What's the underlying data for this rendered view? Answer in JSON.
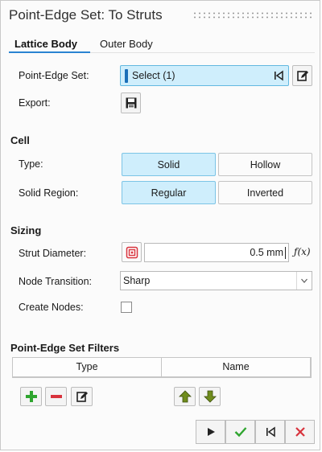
{
  "title": "Point-Edge Set: To Struts",
  "tabs": [
    {
      "label": "Lattice Body",
      "active": true
    },
    {
      "label": "Outer Body",
      "active": false
    }
  ],
  "point_edge_set": {
    "label": "Point-Edge Set:",
    "value": "Select (1)"
  },
  "export": {
    "label": "Export:"
  },
  "cell": {
    "heading": "Cell",
    "type": {
      "label": "Type:",
      "options": [
        "Solid",
        "Hollow"
      ],
      "selected": "Solid"
    },
    "solid_region": {
      "label": "Solid Region:",
      "options": [
        "Regular",
        "Inverted"
      ],
      "selected": "Regular"
    }
  },
  "sizing": {
    "heading": "Sizing",
    "strut_diameter": {
      "label": "Strut Diameter:",
      "value": "0.5 mm",
      "fx": "ƒ(x)"
    },
    "node_transition": {
      "label": "Node Transition:",
      "value": "Sharp"
    },
    "create_nodes": {
      "label": "Create Nodes:",
      "checked": false
    }
  },
  "filters": {
    "heading": "Point-Edge Set Filters",
    "columns": [
      "Type",
      "Name"
    ]
  },
  "colors": {
    "accent": "#2a84d2",
    "selected_bg": "#cfeefc",
    "add": "#2fa52f",
    "remove": "#d8333d",
    "move": "#6f8c1c",
    "cancel": "#d8333d"
  }
}
